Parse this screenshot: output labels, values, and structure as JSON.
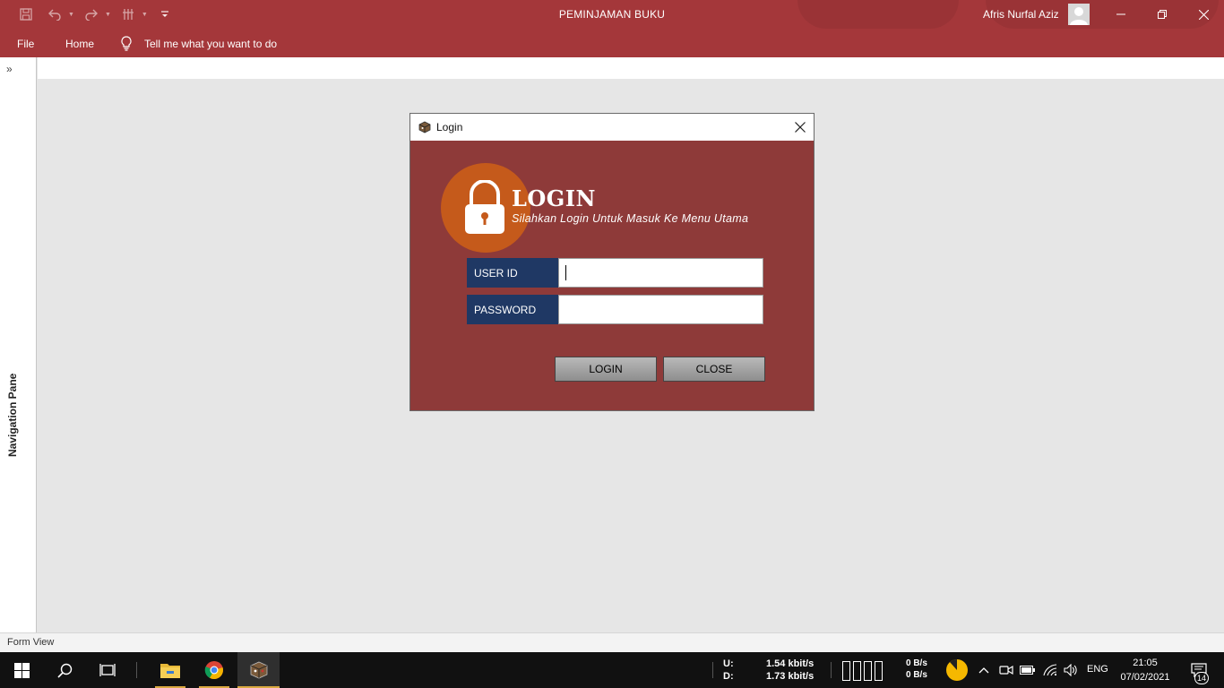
{
  "window": {
    "title": "PEMINJAMAN BUKU",
    "user_name": "Afris Nurfal Aziz"
  },
  "ribbon": {
    "tabs": [
      "File",
      "Home"
    ],
    "tell_me": "Tell me what you want to do"
  },
  "nav_pane": {
    "label": "Navigation Pane",
    "toggle_icon": "double-chevron-right-icon"
  },
  "status_bar": {
    "view": "Form View"
  },
  "dialog": {
    "title": "Login",
    "heading": "LOGIN",
    "subtitle": "Silahkan Login Untuk Masuk Ke Menu Utama",
    "user_id_label": "USER ID",
    "user_id_value": "",
    "password_label": "PASSWORD",
    "password_value": "",
    "login_button": "LOGIN",
    "close_button": "CLOSE"
  },
  "taskbar": {
    "net": {
      "up_label": "U:",
      "down_label": "D:",
      "up_value": "1.54 kbit/s",
      "down_value": "1.73 kbit/s"
    },
    "disk": {
      "read": "0 B/s",
      "write": "0 B/s"
    },
    "language": "ENG",
    "time": "21:05",
    "date": "07/02/2021",
    "notifications": "14"
  },
  "colors": {
    "title_bar": "#a4373a",
    "dialog_body": "#8e3a39",
    "lock_circle": "#c55a1b",
    "field_label": "#1f3864",
    "taskbar": "#111111"
  }
}
